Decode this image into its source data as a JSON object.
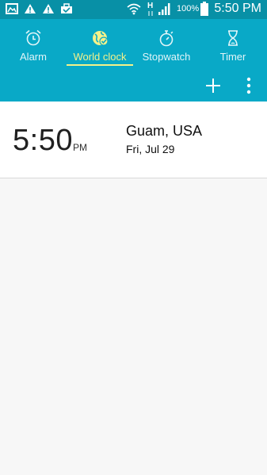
{
  "status_bar": {
    "network_type": "H",
    "battery_percent": "100%",
    "time": "5:50 PM",
    "icons": [
      "gallery-icon",
      "warning-icon",
      "warning-icon",
      "briefcase-icon",
      "wifi-icon",
      "network-h-icon",
      "signal-icon",
      "battery-icon"
    ]
  },
  "tabs": [
    {
      "label": "Alarm",
      "icon": "alarm-icon"
    },
    {
      "label": "World clock",
      "icon": "globe-icon"
    },
    {
      "label": "Stopwatch",
      "icon": "stopwatch-icon"
    },
    {
      "label": "Timer",
      "icon": "hourglass-icon"
    }
  ],
  "active_tab": "World clock",
  "actions": {
    "add": "add-icon",
    "more": "more-options-icon"
  },
  "clocks": [
    {
      "time": "5:50",
      "ampm": "PM",
      "city": "Guam, USA",
      "date": "Fri, Jul 29"
    }
  ],
  "colors": {
    "header": "#09a9c7",
    "status_bar": "#0890a6",
    "active_tab": "#f4f28a",
    "background": "#f7f7f7"
  }
}
